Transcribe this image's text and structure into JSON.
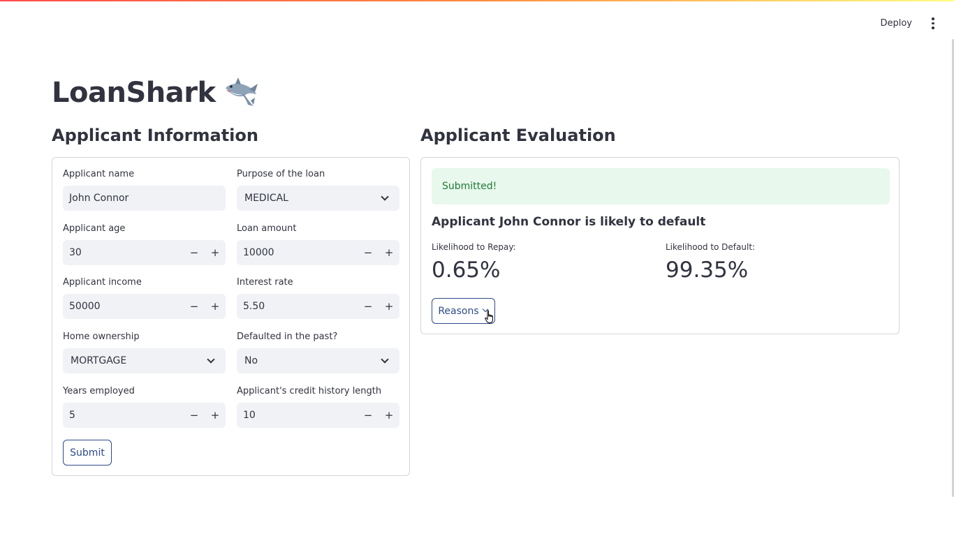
{
  "header": {
    "deploy_label": "Deploy"
  },
  "page": {
    "title": "LoanShark",
    "emoji_icon": "shark-icon"
  },
  "form": {
    "section_title": "Applicant Information",
    "fields": {
      "name": {
        "label": "Applicant name",
        "value": "John Connor"
      },
      "purpose": {
        "label": "Purpose of the loan",
        "value": "MEDICAL"
      },
      "age": {
        "label": "Applicant age",
        "value": "30"
      },
      "amount": {
        "label": "Loan amount",
        "value": "10000"
      },
      "income": {
        "label": "Applicant income",
        "value": "50000"
      },
      "rate": {
        "label": "Interest rate",
        "value": "5.50"
      },
      "home": {
        "label": "Home ownership",
        "value": "MORTGAGE"
      },
      "defaulted": {
        "label": "Defaulted in the past?",
        "value": "No"
      },
      "years": {
        "label": "Years employed",
        "value": "5"
      },
      "credit": {
        "label": "Applicant's credit history length",
        "value": "10"
      }
    },
    "stepper": {
      "minus": "−",
      "plus": "+"
    },
    "submit_label": "Submit"
  },
  "evaluation": {
    "section_title": "Applicant Evaluation",
    "status": "Submitted!",
    "verdict": "Applicant John Connor is likely to default",
    "repay": {
      "label": "Likelihood to Repay:",
      "value": "0.65%"
    },
    "default": {
      "label": "Likelihood to Default:",
      "value": "99.35%"
    },
    "reasons_label": "Reasons"
  },
  "colors": {
    "accent": "#2d4a8a",
    "success_bg": "#e8f8ec",
    "success_text": "#1f7a38",
    "input_bg": "#f0f2f6",
    "text": "#31333f"
  }
}
